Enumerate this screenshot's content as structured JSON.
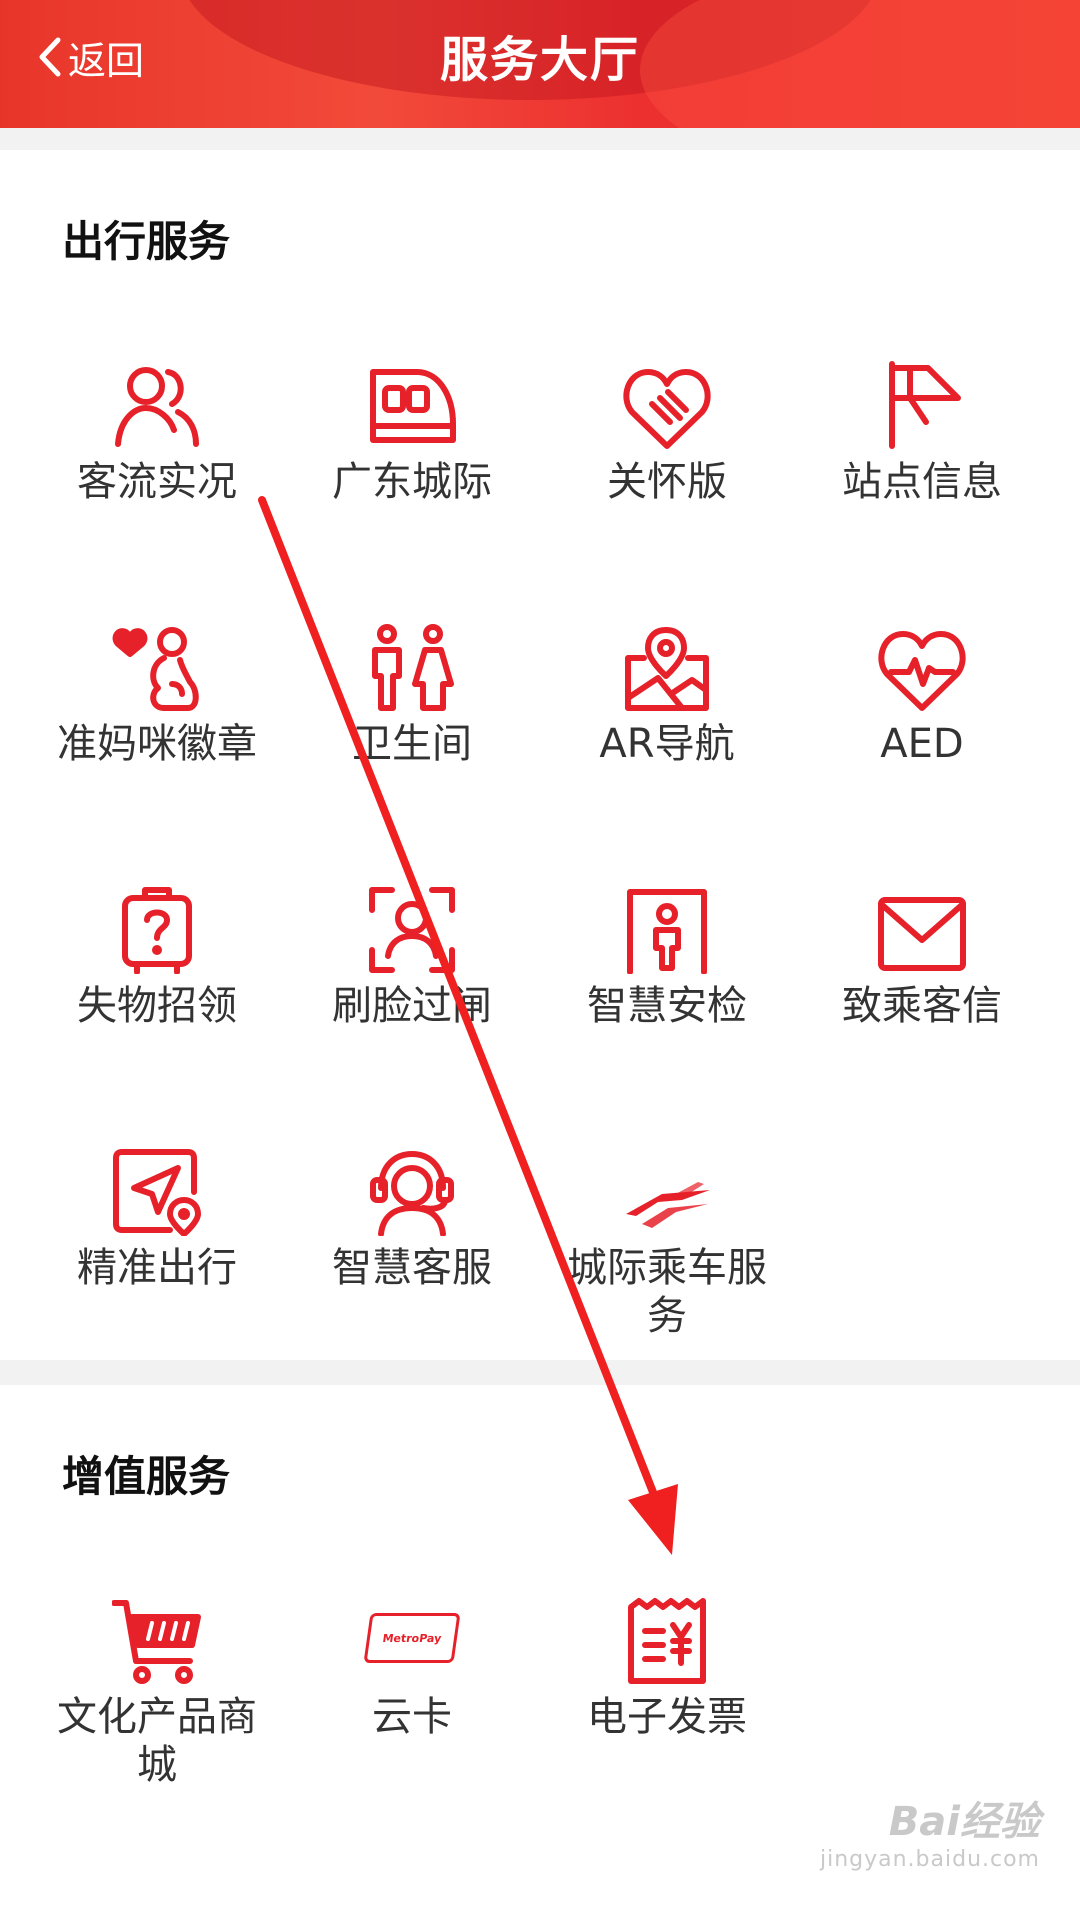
{
  "header": {
    "back_label": "返回",
    "title": "服务大厅",
    "color": "#e8352a"
  },
  "travel": {
    "title": "出行服务",
    "items": [
      {
        "label": "客流实况",
        "icon": "passenger-flow-icon"
      },
      {
        "label": "广东城际",
        "icon": "train-icon"
      },
      {
        "label": "关怀版",
        "icon": "care-handshake-icon"
      },
      {
        "label": "站点信息",
        "icon": "station-flag-icon"
      },
      {
        "label": "准妈咪徽章",
        "icon": "pregnant-badge-icon"
      },
      {
        "label": "卫生间",
        "icon": "restroom-icon"
      },
      {
        "label": "AR导航",
        "icon": "ar-map-icon"
      },
      {
        "label": "AED",
        "icon": "aed-heart-icon"
      },
      {
        "label": "失物招领",
        "icon": "lost-luggage-icon"
      },
      {
        "label": "刷脸过闸",
        "icon": "face-scan-icon"
      },
      {
        "label": "智慧安检",
        "icon": "security-check-icon"
      },
      {
        "label": "致乘客信",
        "icon": "mail-icon"
      },
      {
        "label": "精准出行",
        "icon": "navigation-icon"
      },
      {
        "label": "智慧客服",
        "icon": "customer-service-icon"
      },
      {
        "label": "城际乘车服务",
        "icon": "intercity-logo-icon"
      }
    ]
  },
  "value_added": {
    "title": "增值服务",
    "items": [
      {
        "label": "文化产品商城",
        "icon": "shopping-cart-icon"
      },
      {
        "label": "云卡",
        "icon": "metropay-card-icon"
      },
      {
        "label": "电子发票",
        "icon": "e-invoice-icon"
      }
    ]
  },
  "metropay_text": "MetroPay",
  "watermark": {
    "main": "Bai经验",
    "sub": "jingyan.baidu.com"
  },
  "accent_color": "#e6212a"
}
